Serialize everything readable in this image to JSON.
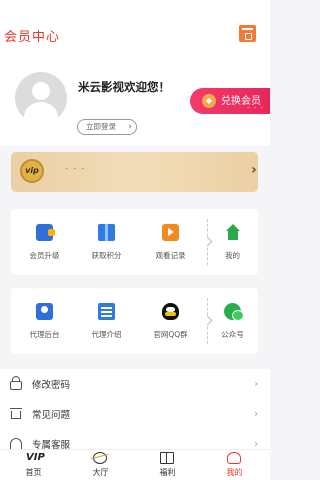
{
  "header": {
    "title": "会员中心",
    "icon": "calendar-icon",
    "accent": "#e8362c"
  },
  "profile": {
    "welcome": "米云影视欢迎您！",
    "login_label": "立即登录",
    "exchange": {
      "label": "兑换会员",
      "sub": "- - -"
    }
  },
  "vip_card": {
    "badge": "vip",
    "text": "- - -"
  },
  "grid1": [
    {
      "label": "会员升级",
      "icon": "wallet-icon"
    },
    {
      "label": "获取积分",
      "icon": "gift-icon"
    },
    {
      "label": "观看记录",
      "icon": "play-icon"
    },
    {
      "label": "我的",
      "icon": "home-icon"
    }
  ],
  "grid2": [
    {
      "label": "代理后台",
      "icon": "agent-icon"
    },
    {
      "label": "代理介绍",
      "icon": "document-icon"
    },
    {
      "label": "官网QQ群",
      "icon": "qq-icon"
    },
    {
      "label": "公众号",
      "icon": "wechat-icon"
    }
  ],
  "menu": [
    {
      "label": "修改密码",
      "icon": "lock-icon"
    },
    {
      "label": "常见问题",
      "icon": "faq-icon"
    },
    {
      "label": "专属客服",
      "icon": "service-icon"
    }
  ],
  "tabs": [
    {
      "label": "首页",
      "icon": "vip-home-icon",
      "glyph": "VIP"
    },
    {
      "label": "大厅",
      "icon": "planet-icon"
    },
    {
      "label": "福利",
      "icon": "gift-box-icon"
    },
    {
      "label": "我的",
      "icon": "user-icon",
      "active": true
    }
  ]
}
